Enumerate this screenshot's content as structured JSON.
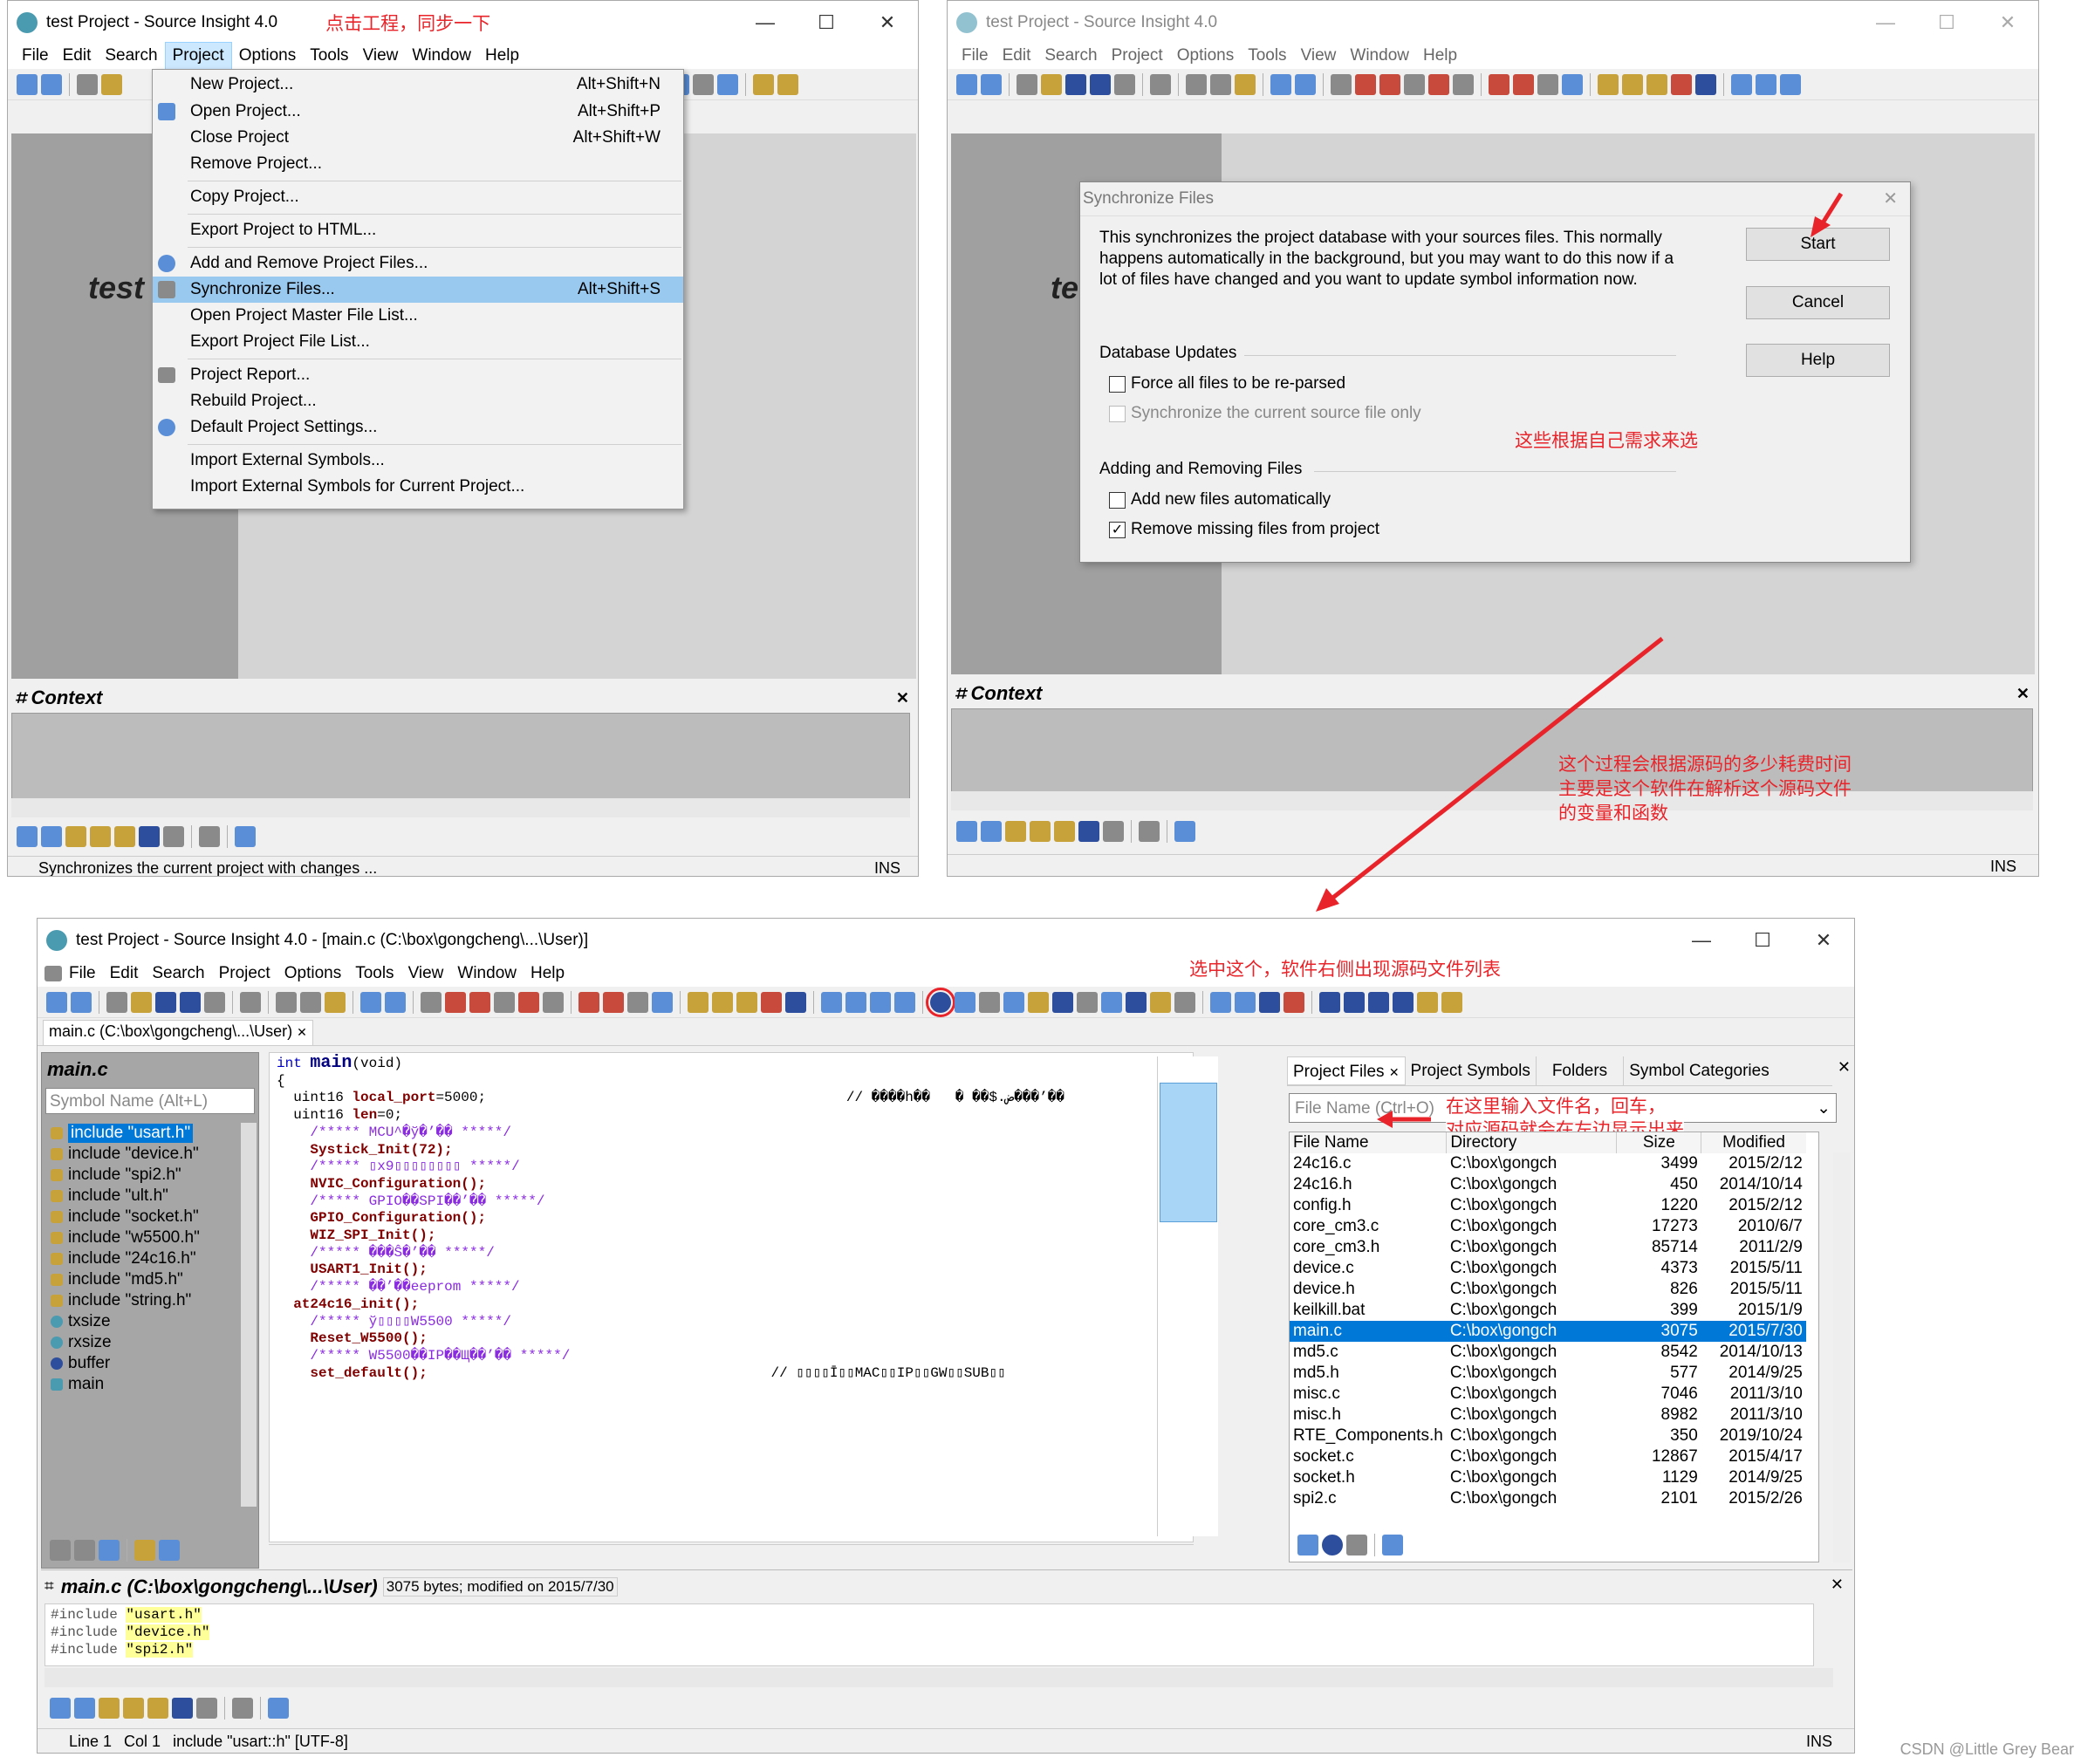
{
  "top_left": {
    "title": "test Project - Source Insight 4.0",
    "annotation": "点击工程，同步一下",
    "menubar": [
      "File",
      "Edit",
      "Search",
      "Project",
      "Options",
      "Tools",
      "View",
      "Window",
      "Help"
    ],
    "partial_text": "test",
    "context_label": "Context",
    "status": "Synchronizes the current project with changes ...",
    "ins": "INS",
    "menu": [
      {
        "label": "New Project...",
        "shortcut": "Alt+Shift+N"
      },
      {
        "label": "Open Project...",
        "shortcut": "Alt+Shift+P"
      },
      {
        "label": "Close Project",
        "shortcut": "Alt+Shift+W"
      },
      {
        "label": "Remove Project...",
        "shortcut": ""
      },
      {
        "label": "Copy Project...",
        "shortcut": ""
      },
      {
        "label": "Export Project to HTML...",
        "shortcut": ""
      },
      {
        "label": "Add and Remove Project Files...",
        "shortcut": ""
      },
      {
        "label": "Synchronize Files...",
        "shortcut": "Alt+Shift+S"
      },
      {
        "label": "Open Project Master File List...",
        "shortcut": ""
      },
      {
        "label": "Export Project File List...",
        "shortcut": ""
      },
      {
        "label": "Project Report...",
        "shortcut": ""
      },
      {
        "label": "Rebuild Project...",
        "shortcut": ""
      },
      {
        "label": "Default Project Settings...",
        "shortcut": ""
      },
      {
        "label": "Import External Symbols...",
        "shortcut": ""
      },
      {
        "label": "Import External Symbols for Current Project...",
        "shortcut": ""
      }
    ]
  },
  "top_right": {
    "title": "test Project - Source Insight 4.0",
    "menubar": [
      "File",
      "Edit",
      "Search",
      "Project",
      "Options",
      "Tools",
      "View",
      "Window",
      "Help"
    ],
    "partial_text": "te",
    "context_label": "Context",
    "ins": "INS",
    "dialog": {
      "title": "Synchronize Files",
      "description": "This synchronizes the project database with your sources files. This normally happens automatically in the background, but you may want to do this now if a lot of files have changed and you want to update symbol information now.",
      "start": "Start",
      "cancel": "Cancel",
      "help": "Help",
      "db_updates": "Database Updates",
      "force": "Force all files to be re-parsed",
      "sync_current": "Synchronize the current source file only",
      "adding_removing": "Adding and Removing Files",
      "add_new": "Add new files automatically",
      "remove_missing": "Remove missing files from project",
      "annotation": "这些根据自己需求来选"
    }
  },
  "annotation_mid": [
    "这个过程会根据源码的多少耗费时间",
    "主要是这个软件在解析这个源码文件",
    "的变量和函数"
  ],
  "bottom": {
    "title": "test Project - Source Insight 4.0 - [main.c (C:\\box\\gongcheng\\...\\User)]",
    "menubar": [
      "File",
      "Edit",
      "Search",
      "Project",
      "Options",
      "Tools",
      "View",
      "Window",
      "Help"
    ],
    "annotation_toolbar": "选中这个，软件右侧出现源码文件列表",
    "tab": "main.c (C:\\box\\gongcheng\\...\\User)",
    "symbol_panel": {
      "title": "main.c",
      "placeholder": "Symbol Name (Alt+L)",
      "items": [
        "include \"usart.h\"",
        "include \"device.h\"",
        "include \"spi2.h\"",
        "include \"ult.h\"",
        "include \"socket.h\"",
        "include \"w5500.h\"",
        "include \"24c16.h\"",
        "include \"md5.h\"",
        "include \"string.h\"",
        "txsize",
        "rxsize",
        "buffer",
        "main"
      ]
    },
    "code": [
      {
        "t": "int ",
        "c": "kw",
        "u": "main",
        "uc": "fn",
        "r": "(void)"
      },
      {
        "t": "{",
        "c": "",
        "u": "",
        "uc": "",
        "r": ""
      },
      {
        "t": "  uint16 ",
        "c": "",
        "u": "local_port",
        "uc": "fn",
        "r": "=5000;                                           // ����h��   � ��$.ض���’��"
      },
      {
        "t": "  uint16 ",
        "c": "",
        "u": "len",
        "uc": "fn",
        "r": "=0;"
      },
      {
        "t": "",
        "c": "",
        "u": "",
        "uc": "",
        "r": ""
      },
      {
        "t": "    /***** MCU^�ў�’�� *****/",
        "c": "cm",
        "u": "",
        "uc": "",
        "r": ""
      },
      {
        "t": "    Systick_Init(72);",
        "c": "fn",
        "u": "",
        "uc": "",
        "r": ""
      },
      {
        "t": "",
        "c": "",
        "u": "",
        "uc": "",
        "r": ""
      },
      {
        "t": "    /***** ▯х9▯▯▯▯▯▯▯▯ *****/",
        "c": "cm",
        "u": "",
        "uc": "",
        "r": ""
      },
      {
        "t": "    NVIC_Configuration();",
        "c": "fn",
        "u": "",
        "uc": "",
        "r": ""
      },
      {
        "t": "",
        "c": "",
        "u": "",
        "uc": "",
        "r": ""
      },
      {
        "t": "    /***** GPIO��SPI��’�� *****/",
        "c": "cm",
        "u": "",
        "uc": "",
        "r": ""
      },
      {
        "t": "    GPIO_Configuration();",
        "c": "fn",
        "u": "",
        "uc": "",
        "r": ""
      },
      {
        "t": "    WIZ_SPI_Init();",
        "c": "fn",
        "u": "",
        "uc": "",
        "r": ""
      },
      {
        "t": "",
        "c": "",
        "u": "",
        "uc": "",
        "r": ""
      },
      {
        "t": "    /***** ���Ŝ�’�� *****/",
        "c": "cm",
        "u": "",
        "uc": "",
        "r": ""
      },
      {
        "t": "    USART1_Init();",
        "c": "fn",
        "u": "",
        "uc": "",
        "r": ""
      },
      {
        "t": "",
        "c": "",
        "u": "",
        "uc": "",
        "r": ""
      },
      {
        "t": "    /***** ��’��eeprom *****/",
        "c": "cm",
        "u": "",
        "uc": "",
        "r": ""
      },
      {
        "t": "  at24c16_init();",
        "c": "fn",
        "u": "",
        "uc": "",
        "r": ""
      },
      {
        "t": "",
        "c": "",
        "u": "",
        "uc": "",
        "r": ""
      },
      {
        "t": "    /***** ў▯▯▯▯W5500 *****/",
        "c": "cm",
        "u": "",
        "uc": "",
        "r": ""
      },
      {
        "t": "    Reset_W5500();",
        "c": "fn",
        "u": "",
        "uc": "",
        "r": ""
      },
      {
        "t": "",
        "c": "",
        "u": "",
        "uc": "",
        "r": ""
      },
      {
        "t": "    /***** W5500��IP��Щ��’�� *****/",
        "c": "cm",
        "u": "",
        "uc": "",
        "r": ""
      },
      {
        "t": "    set_default();",
        "c": "fn",
        "u": "",
        "uc": "",
        "r": "                                         // ▯▯▯▯Ī▯▯MAC▯▯IP▯▯GW▯▯SUB▯▯"
      }
    ],
    "file_panel": {
      "tabs": [
        "Project Files",
        "Project Symbols",
        "Folders",
        "Symbol Categories"
      ],
      "placeholder": "File Name (Ctrl+O)",
      "annotation": [
        "在这里输入文件名，回车，",
        "对应源码就会在左边显示出来"
      ],
      "columns": [
        "File Name",
        "Directory",
        "Size",
        "Modified"
      ],
      "rows": [
        [
          "24c16.c",
          "C:\\box\\gongch",
          "3499",
          "2015/2/12"
        ],
        [
          "24c16.h",
          "C:\\box\\gongch",
          "450",
          "2014/10/14"
        ],
        [
          "config.h",
          "C:\\box\\gongch",
          "1220",
          "2015/2/12"
        ],
        [
          "core_cm3.c",
          "C:\\box\\gongch",
          "17273",
          "2010/6/7"
        ],
        [
          "core_cm3.h",
          "C:\\box\\gongch",
          "85714",
          "2011/2/9"
        ],
        [
          "device.c",
          "C:\\box\\gongch",
          "4373",
          "2015/5/11"
        ],
        [
          "device.h",
          "C:\\box\\gongch",
          "826",
          "2015/5/11"
        ],
        [
          "keilkill.bat",
          "C:\\box\\gongch",
          "399",
          "2015/1/9"
        ],
        [
          "main.c",
          "C:\\box\\gongch",
          "3075",
          "2015/7/30"
        ],
        [
          "md5.c",
          "C:\\box\\gongch",
          "8542",
          "2014/10/13"
        ],
        [
          "md5.h",
          "C:\\box\\gongch",
          "577",
          "2014/9/25"
        ],
        [
          "misc.c",
          "C:\\box\\gongch",
          "7046",
          "2011/3/10"
        ],
        [
          "misc.h",
          "C:\\box\\gongch",
          "8982",
          "2011/3/10"
        ],
        [
          "RTE_Components.h",
          "C:\\box\\gongch",
          "350",
          "2019/10/24"
        ],
        [
          "socket.c",
          "C:\\box\\gongch",
          "12867",
          "2015/4/17"
        ],
        [
          "socket.h",
          "C:\\box\\gongch",
          "1129",
          "2014/9/25"
        ],
        [
          "spi2.c",
          "C:\\box\\gongch",
          "2101",
          "2015/2/26"
        ]
      ],
      "selected": 8
    },
    "context": {
      "title": "main.c (C:\\box\\gongcheng\\...\\User)",
      "info": "3075 bytes; modified on 2015/7/30",
      "lines": [
        {
          "a": "#include ",
          "b": "\"usart.h\""
        },
        {
          "a": "#include ",
          "b": "\"device.h\""
        },
        {
          "a": "#include ",
          "b": "\"spi2.h\""
        }
      ]
    },
    "status": {
      "line": "Line 1",
      "col": "Col 1",
      "info": "include \"usart::h\" [UTF-8]",
      "ins": "INS"
    }
  },
  "watermark": "CSDN @Little Grey Bear",
  "colors": {
    "annotation": "#e8242a",
    "selection": "#0078d7",
    "menu_highlight": "#99c9ef"
  }
}
